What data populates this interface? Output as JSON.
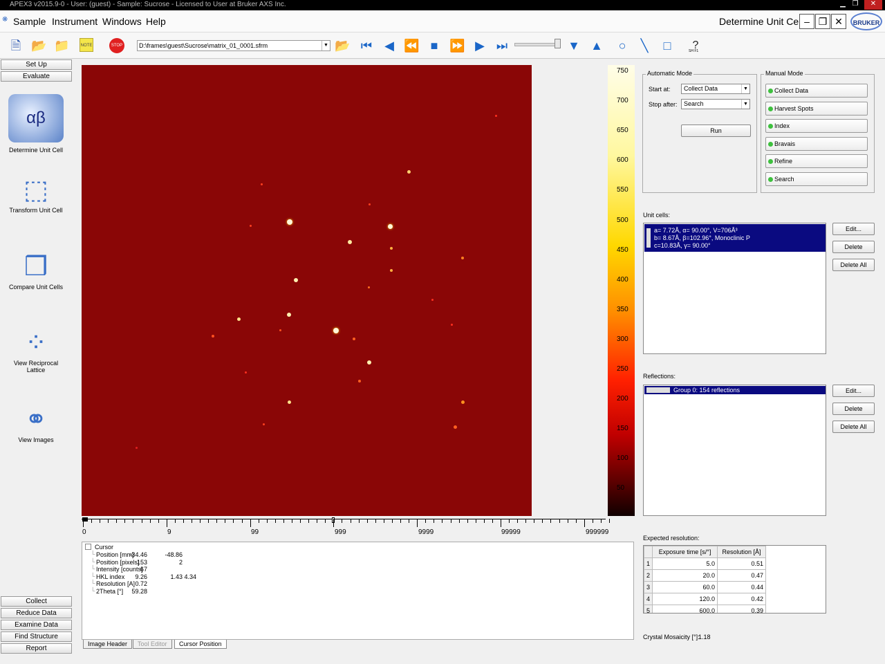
{
  "window": {
    "title": "APEX3 v2015.9-0 - User: (guest) - Sample: Sucrose - Licensed to User at Bruker AXS Inc."
  },
  "menu": {
    "items": [
      "Sample",
      "Instrument",
      "Windows",
      "Help"
    ],
    "mode_title": "Determine Unit Cell",
    "logo": "BRUKER"
  },
  "toolbar": {
    "file_path": "D:\\frames\\guest\\Sucrose\\matrix_01_0001.sfrm",
    "note_label": "NOTE",
    "stop_label": "STOP",
    "help_label": "SH F1"
  },
  "sidebar": {
    "top_buttons": [
      "Set Up",
      "Evaluate"
    ],
    "tools": [
      "Determine Unit Cell",
      "Transform Unit Cell",
      "Compare Unit Cells",
      "View Reciprocal Lattice",
      "View Images"
    ],
    "bottom_buttons": [
      "Collect",
      "Reduce Data",
      "Examine Data",
      "Find Structure",
      "Report"
    ]
  },
  "colorbar": {
    "labels": [
      "750",
      "700",
      "650",
      "600",
      "550",
      "500",
      "450",
      "400",
      "350",
      "300",
      "250",
      "200",
      "150",
      "100",
      "50"
    ]
  },
  "axis": {
    "labels": [
      "0",
      "9",
      "99",
      "999",
      "9999",
      "99999",
      "999999"
    ]
  },
  "cursor_info": {
    "header": "Cursor",
    "rows": [
      {
        "label": "Position [mm]",
        "v1": "-34.46",
        "v2": "-48.86",
        "v3": ""
      },
      {
        "label": "Position [pixels]",
        "v1": "153",
        "v2": "2",
        "v3": ""
      },
      {
        "label": "Intensity [counts]",
        "v1": "67",
        "v2": "",
        "v3": ""
      },
      {
        "label": "HKL index",
        "v1": "9.26",
        "v2": "1.43",
        "v3": "4.34"
      },
      {
        "label": "Resolution [A]",
        "v1": "0.72",
        "v2": "",
        "v3": ""
      },
      {
        "label": "2Theta [°]",
        "v1": "59.28",
        "v2": "",
        "v3": ""
      }
    ]
  },
  "tabs": [
    "Image Header",
    "Tool Editor",
    "Cursor Position"
  ],
  "automatic_mode": {
    "legend": "Automatic Mode",
    "start_label": "Start at:",
    "start_value": "Collect Data",
    "stop_label": "Stop after:",
    "stop_value": "Search",
    "run_label": "Run"
  },
  "manual_mode": {
    "legend": "Manual Mode",
    "buttons": [
      "Collect Data",
      "Harvest Spots",
      "Index",
      "Bravais",
      "Refine",
      "Search"
    ]
  },
  "unit_cells": {
    "label": "Unit cells:",
    "line1": "a=  7.72Å,  α=  90.00°,  V=706Å³",
    "line2": "b=  8.67Å,  β=102.96°,  Monoclinic P",
    "line3": "c=10.83Å,  γ=  90.00°",
    "buttons": [
      "Edit...",
      "Delete",
      "Delete All"
    ]
  },
  "reflections": {
    "label": "Reflections:",
    "selected": "Group 0: 154 reflections",
    "buttons": [
      "Edit...",
      "Delete",
      "Delete All"
    ]
  },
  "expected_resolution": {
    "label": "Expected resolution:",
    "headers": [
      "Exposure time [s/°]",
      "Resolution [Å]"
    ],
    "rows": [
      {
        "n": "1",
        "exposure": "5.0",
        "resolution": "0.51"
      },
      {
        "n": "2",
        "exposure": "20.0",
        "resolution": "0.47"
      },
      {
        "n": "3",
        "exposure": "60.0",
        "resolution": "0.44"
      },
      {
        "n": "4",
        "exposure": "120.0",
        "resolution": "0.42"
      },
      {
        "n": "5",
        "exposure": "600.0",
        "resolution": "0.39"
      }
    ]
  },
  "mosaicity": {
    "label": "Crystal Mosaicity [°]:",
    "value": "1.18"
  },
  "colors": {
    "frame_bg": "#8a0606",
    "selection": "#0a0a80",
    "status_green": "#3ec03e"
  }
}
